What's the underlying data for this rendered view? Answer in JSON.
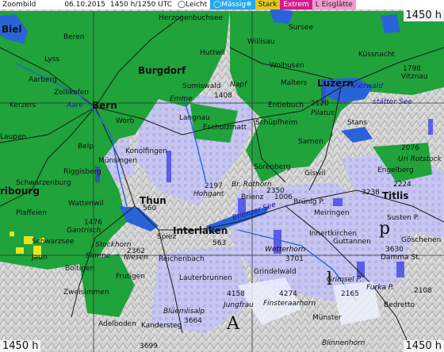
{
  "header": {
    "title": "Zoombild",
    "date": "06.10.2015",
    "time": "1450 h/1250 UTC",
    "legend": [
      {
        "label": "Leicht",
        "color": "#ffffff"
      },
      {
        "label": "Mässig",
        "color": "#22a7f0"
      },
      {
        "label": "Stark",
        "color": "#e6c619"
      },
      {
        "label": "Extrem",
        "color": "#d21c8e"
      },
      {
        "label": "Eisglätte",
        "color": "#f19bd0"
      }
    ],
    "eis_prefix": "L"
  },
  "corners": {
    "top_right": "1450 h",
    "bottom_left": "1450 h",
    "bottom_right": "1450 h"
  },
  "colors": {
    "forest": "#1fa33a",
    "mountain": "#d0d0d0",
    "precip_light": "#c9c9f5",
    "precip_mod": "#3a3ae6",
    "yellow_cells": "#e6e61e",
    "lake": "#2a63d8",
    "road": "#222222",
    "grid": "#444444"
  },
  "places": {
    "biel": "Biel",
    "beren": "Beren",
    "herzogenbuchsee": "Herzogenbuchsee",
    "huttwil": "Huttwil",
    "willisau": "Willisau",
    "sursee": "Sursee",
    "lyss": "Lyss",
    "aarberg": "Aarberg",
    "zollikofen": "Zollikofen",
    "burgdorf": "Burgdorf",
    "sumiswald": "Sumiswald",
    "napf": "Napf",
    "wolhusen": "Wolhusen",
    "malters": "Malters",
    "luzern": "Luzern",
    "kerzers": "Kerzers",
    "bern": "Bern",
    "worb": "Worb",
    "langnau": "Langnau",
    "escholzmatt": "Escholzmatt",
    "entlebuch": "Entlebuch",
    "schupfheim": "Schüpfheim",
    "pilatus": "Pilatus",
    "stans": "Stans",
    "laupen": "Laupen",
    "belp": "Belp",
    "konolfingen": "Konolfingen",
    "munsingen": "Münsingen",
    "sarnen": "Sarnen",
    "sorenberg": "Sörenberg",
    "giswil": "Giswil",
    "engelberg": "Engelberg",
    "riggisberg": "Riggisberg",
    "schwarzenburg": "Schwarzenburg",
    "fribourg": "ribourg",
    "thun": "Thun",
    "hohgant": "Hohgant",
    "brienz": "Brienz",
    "brthorn": "Br. Rothorn",
    "brunig": "Brünig P.",
    "meiringen": "Meiringen",
    "titlis": "Titlis",
    "sustenp": "Susten P.",
    "wattenwil": "Wattenwil",
    "plaffeien": "Plaffeien",
    "gantrisch": "Gantrisch",
    "schwarzsee": "Schwarzsee",
    "spiez": "Spiez",
    "interlaken": "Interlaken",
    "innertkirchen": "Innertkirchen",
    "guttannen": "Guttannen",
    "goschenen": "Göschenen",
    "jaun": "Jaun",
    "stockhorn": "Stockhorn",
    "simme": "Simme",
    "niesen": "Niesen",
    "reichenbach": "Reichenbach",
    "wetterhorn": "Wetterhorn",
    "dammast": "Damma St.",
    "grindelwald": "Grindelwald",
    "lauterbrunnen": "Lauterbrunnen",
    "frutigen": "Frutigen",
    "boltigen": "Boltigen",
    "zweisimmen": "Zweisimmen",
    "grimselp": "Grimsel P.",
    "furkap": "Furka P.",
    "jungfrau": "Jungfrau",
    "finsteraarhorn": "Finsteraarhorn",
    "blumlisalp": "Blüemlisalp",
    "kandersteg": "Kandersteg",
    "munster": "Münster",
    "bedretto": "Bedretto",
    "adelboden": "Adelboden",
    "blinnenhorn": "Blinnenhorn",
    "vitznau": "Vitznau",
    "kussnacht": "Küssnacht",
    "uriro": "Uri Rotstock",
    "emme": "Emme",
    "brienzersee": "Brienzer See",
    "stattersee": "stätter See",
    "vierwald": "Vierwald",
    "aare": "Aare",
    "region_a": "A",
    "region_l": "l",
    "region_p": "p",
    "region_e": "e",
    "n1": "1798",
    "n2": "2120",
    "n3": "2224",
    "n4": "3238",
    "n5": "2350",
    "n6": "2197",
    "n7": "1408",
    "n8": "2362",
    "n9": "3701",
    "n10": "3630",
    "n11": "3664",
    "n12": "4158",
    "n13": "4274",
    "n14": "2165",
    "n15": "3699",
    "n16": "1006",
    "n17": "2108",
    "n18": "1476",
    "n19": "2076",
    "n20": "563",
    "n21": "560"
  }
}
